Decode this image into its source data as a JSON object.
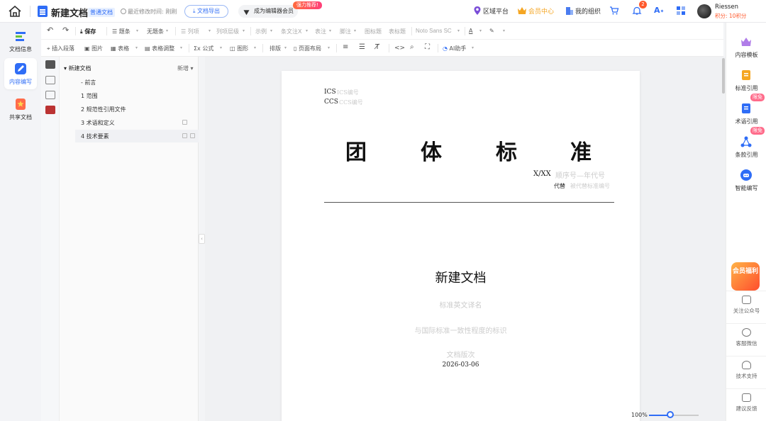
{
  "header": {
    "doc_title": "新建文档",
    "doc_type": "普通文档",
    "last_modified": "最近修改时间: 刚刚",
    "export_label": "文档导出",
    "editor_cta": "成为编辑器会员",
    "hot_badge": "强力推荐!",
    "region_label": "区域平台",
    "member_center": "会员中心",
    "my_org": "我的组织",
    "notif_count": "2",
    "user_name": "Riessen",
    "user_points": "积分: 10积分",
    "accent": "#2f6df6"
  },
  "left_nav": [
    {
      "label": "文档信息",
      "icon": "doc-info-icon"
    },
    {
      "label": "内容编写",
      "icon": "edit-content-icon"
    },
    {
      "label": "共享文档",
      "icon": "share-doc-icon"
    }
  ],
  "toolbar": {
    "row1": [
      "保存",
      "题条",
      "无题条",
      "列项",
      "列项层级",
      "示例",
      "条文注X",
      "表注",
      "脚注",
      "图标题",
      "表标题",
      "Noto Sans SC"
    ],
    "row2": [
      "插入段落",
      "图片",
      "表格",
      "表格调整",
      "公式",
      "图形",
      "排版",
      "页面布局",
      "AI助手"
    ]
  },
  "outline": {
    "root": "新建文档",
    "add_label": "新增",
    "items": [
      "前言",
      "1 范围",
      "2 规范性引用文件",
      "3 术语和定义",
      "4 技术要素"
    ]
  },
  "page": {
    "ics_label": "ICS",
    "ics_placeholder": "ICS编号",
    "ccs_label": "CCS",
    "ccs_placeholder": "CCS编号",
    "std_title_chars": [
      "团",
      "体",
      "标",
      "准"
    ],
    "std_no": "X/XX",
    "std_no_placeholder": "顺序号—年代号",
    "replace_label": "代替",
    "replace_placeholder": "被代替标准编号",
    "doc_name": "新建文档",
    "english_name_placeholder": "标准英文译名",
    "consistency_placeholder": "与国际标准一致性程度的标识",
    "version_placeholder": "文档版次",
    "date": "2026-03-06"
  },
  "zoom": {
    "label": "100%",
    "level": 0.43
  },
  "right_panel": [
    {
      "label": "内容模板",
      "icon": "template-icon",
      "badge": ""
    },
    {
      "label": "标准引用",
      "icon": "standard-ref-icon",
      "badge": ""
    },
    {
      "label": "术语引用",
      "icon": "term-ref-icon",
      "badge": "限免"
    },
    {
      "label": "条款引用",
      "icon": "clause-ref-icon",
      "badge": "限免"
    },
    {
      "label": "智能编写",
      "icon": "ai-write-icon",
      "badge": ""
    }
  ],
  "promo_label": "会员福利",
  "right_small": [
    {
      "label": "关注公众号",
      "icon": "wechat-icon"
    },
    {
      "label": "客服微信",
      "icon": "headset-icon"
    },
    {
      "label": "技术支持",
      "icon": "support-icon"
    },
    {
      "label": "建议反馈",
      "icon": "feedback-icon"
    }
  ]
}
